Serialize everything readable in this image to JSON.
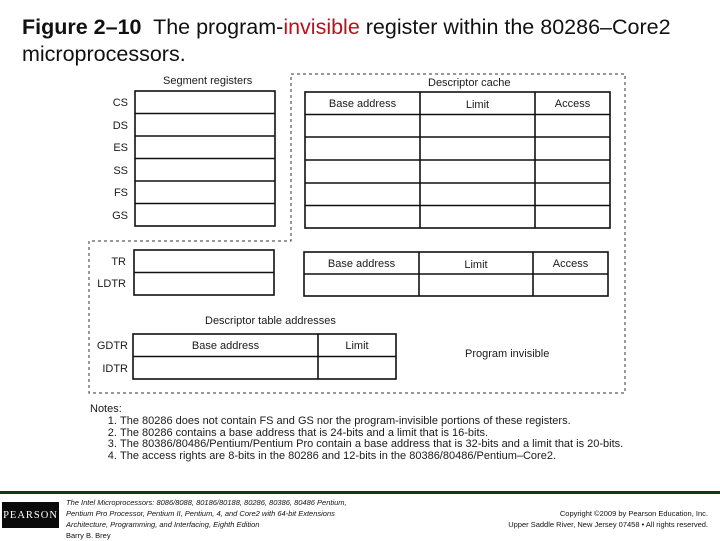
{
  "title": {
    "figure_label": "Figure 2–10",
    "text_before": "The program-",
    "highlight": "invisible",
    "text_after": " register within the 80286–Core2 microprocessors.",
    "highlight_color": "#b3141c"
  },
  "diagram": {
    "segment_registers": {
      "heading": "Segment registers",
      "registers": [
        "CS",
        "DS",
        "ES",
        "SS",
        "FS",
        "GS"
      ]
    },
    "descriptor_cache": {
      "heading": "Descriptor cache",
      "columns": [
        "Base address",
        "Limit",
        "Access"
      ]
    },
    "system_registers": {
      "registers": [
        "TR",
        "LDTR"
      ],
      "cache_columns": [
        "Base address",
        "Limit",
        "Access"
      ]
    },
    "descriptor_table_addresses": {
      "heading": "Descriptor table addresses",
      "registers": [
        "GDTR",
        "IDTR"
      ],
      "columns": [
        "Base address",
        "Limit"
      ]
    },
    "region_label": "Program invisible"
  },
  "notes": {
    "heading": "Notes:",
    "items": [
      "The 80286 does not contain FS and GS nor the program-invisible portions of these registers.",
      "The 80286 contains a base address that is 24-bits and a limit that is 16-bits.",
      "The 80386/80486/Pentium/Pentium Pro contain a base address that is 32-bits and a limit that is 20-bits.",
      "The access rights are 8-bits in the 80286 and 12-bits in the 80386/80486/Pentium–Core2."
    ]
  },
  "footer": {
    "logo_text": "PEARSON",
    "book_line1": "The Intel Microprocessors: 8086/8088, 80186/80188, 80286, 80386, 80486 Pentium,",
    "book_line2": "Pentium Pro Processor, Pentium II, Pentium, 4, and Core2 with 64-bit Extensions",
    "book_line3": "Architecture, Programming, and Interfacing, Eighth Edition",
    "author": "Barry B. Brey",
    "copyright_line1": "Copyright ©2009 by Pearson Education, Inc.",
    "copyright_line2": "Upper Saddle River, New Jersey 07458 • All rights reserved.",
    "rule_color": "#0f3a12"
  }
}
